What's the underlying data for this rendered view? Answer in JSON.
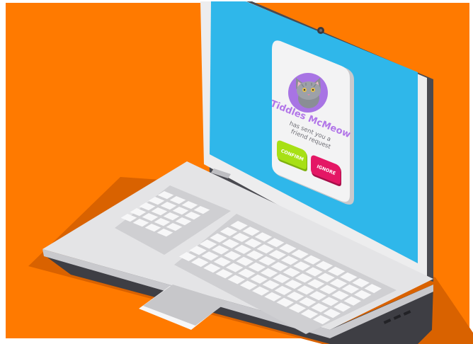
{
  "colors": {
    "background": "#FF7A00",
    "screen": "#2FB7EA",
    "lid_frame": "#EDEDEE",
    "base": "#E4E4E6",
    "keys": "#F7F7F8",
    "shadow": "#D96200",
    "confirm": "#A7E015",
    "ignore": "#E41765",
    "title": "#B276E8"
  },
  "notification": {
    "avatar_icon": "cat-avatar-icon",
    "name": "Tiddles McMeow",
    "message_line1": "has sent you a",
    "message_line2": "friend request",
    "confirm_label": "CONFIRM",
    "ignore_label": "IGNORE"
  }
}
